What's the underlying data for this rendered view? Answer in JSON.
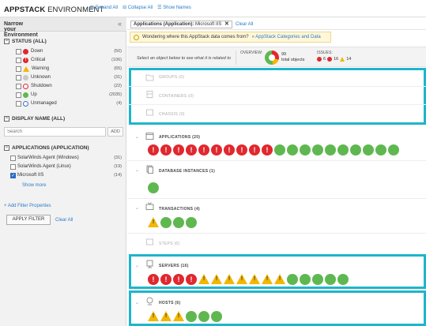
{
  "header": {
    "title_bold": "APPSTACK",
    "title_rest": " ENVIRONMENT",
    "expand_all": "Expand All",
    "collapse_all": "Collapse All",
    "show_names": "Show Names"
  },
  "sidebar": {
    "title": "Narrow your Environment",
    "collapse_glyph": "«",
    "status_group": "STATUS (ALL)",
    "status_items": [
      {
        "label": "Down",
        "count": "(50)"
      },
      {
        "label": "Critical",
        "count": "(106)"
      },
      {
        "label": "Warning",
        "count": "(65)"
      },
      {
        "label": "Unknown",
        "count": "(31)"
      },
      {
        "label": "Shutdown",
        "count": "(22)"
      },
      {
        "label": "Up",
        "count": "(2035)"
      },
      {
        "label": "Unmanaged",
        "count": "(4)"
      }
    ],
    "display_group": "DISPLAY NAME (ALL)",
    "search_placeholder": "Search",
    "add_label": "ADD",
    "app_group": "APPLICATIONS (APPLICATION)",
    "app_items": [
      {
        "label": "SolarWinds Agent (Windows)",
        "count": "(31)",
        "checked": false
      },
      {
        "label": "SolarWinds Agent (Linux)",
        "count": "(19)",
        "checked": false
      },
      {
        "label": "Microsoft IIS",
        "count": "(14)",
        "checked": true
      }
    ],
    "show_more": "Show more",
    "add_filter": "+ Add Filter Properties",
    "apply_filter": "APPLY FILTER",
    "clear_all": "Clear All"
  },
  "main": {
    "chip_key": "Applications (Application):",
    "chip_value": " Microsoft IIS",
    "chip_remove": "✕",
    "clear_all": "Clear All",
    "notice_text": "Wondering where this AppStack data comes from?",
    "notice_link": "» AppStack Categories and Data",
    "select_hint": "Select an object below to see what it is related to",
    "overview_label": "OVERVIEW:",
    "total_count": "99",
    "total_label": "total objects",
    "issues_label": "ISSUES:",
    "issues": {
      "down": "6",
      "critical": "16",
      "warning": "14"
    },
    "sections": [
      {
        "label": "GROUPS (0)",
        "dim": true
      },
      {
        "label": "CONTAINERS (0)",
        "dim": true
      },
      {
        "label": "CHASSIS (0)",
        "dim": true
      },
      {
        "label": "APPLICATIONS (20)",
        "dim": false,
        "tiles": [
          "crit",
          "crit",
          "crit",
          "crit",
          "crit",
          "crit",
          "crit",
          "crit",
          "crit",
          "crit",
          "up",
          "up",
          "up",
          "up",
          "up",
          "up",
          "up",
          "up",
          "up",
          "up"
        ]
      },
      {
        "label": "DATABASE INSTANCES (1)",
        "dim": false,
        "tiles": [
          "up"
        ]
      },
      {
        "label": "TRANSACTIONS (4)",
        "dim": false,
        "tiles": [
          "warn",
          "up",
          "up",
          "up"
        ]
      },
      {
        "label": "STEPS (0)",
        "dim": true
      },
      {
        "label": "SERVERS (16)",
        "dim": false,
        "tiles": [
          "crit",
          "crit",
          "crit",
          "crit",
          "warn",
          "warn",
          "warn",
          "warn",
          "warn",
          "warn",
          "warn",
          "up",
          "up",
          "up",
          "up",
          "up"
        ]
      },
      {
        "label": "HOSTS (6)",
        "dim": false,
        "tiles": [
          "warn",
          "warn",
          "warn",
          "up",
          "up",
          "up"
        ]
      }
    ]
  }
}
